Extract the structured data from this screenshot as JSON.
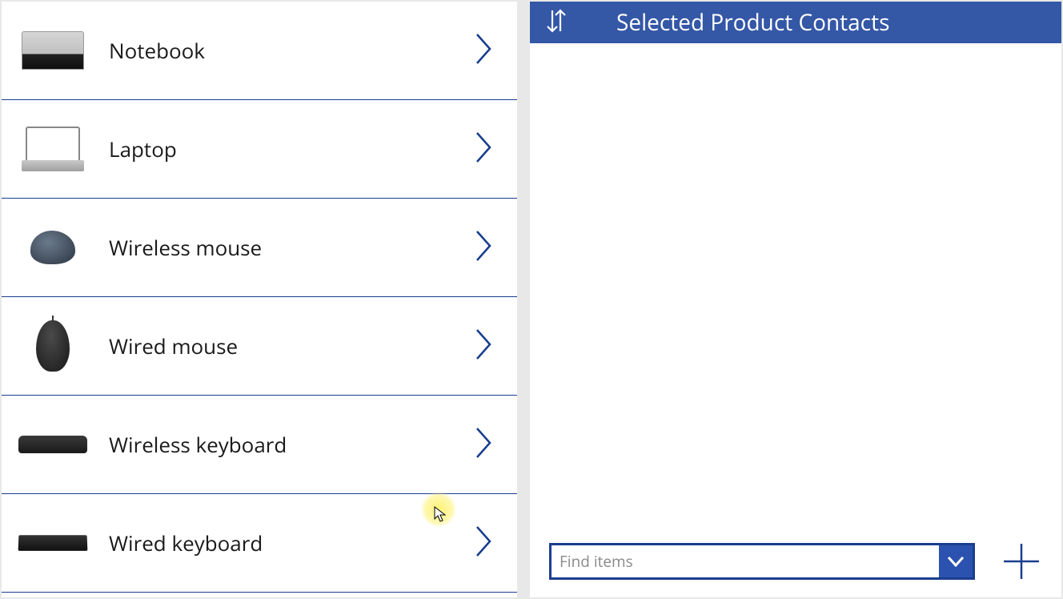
{
  "products": [
    {
      "label": "Notebook",
      "thumb": "notebook"
    },
    {
      "label": "Laptop",
      "thumb": "laptop"
    },
    {
      "label": "Wireless mouse",
      "thumb": "mouse-wireless"
    },
    {
      "label": "Wired mouse",
      "thumb": "mouse-wired"
    },
    {
      "label": "Wireless keyboard",
      "thumb": "keyboard-wireless"
    },
    {
      "label": "Wired keyboard",
      "thumb": "keyboard-wired"
    }
  ],
  "contacts_panel": {
    "title": "Selected Product Contacts"
  },
  "find_items": {
    "placeholder": "Find items"
  },
  "colors": {
    "primary": "#3457a6",
    "border": "#1a3e8f"
  }
}
